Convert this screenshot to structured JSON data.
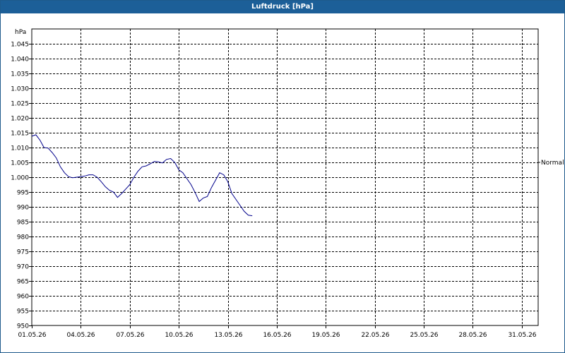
{
  "window": {
    "title": "Luftdruck [hPa]"
  },
  "chart_data": {
    "type": "line",
    "title": "Luftdruck [hPa]",
    "ylabel": "hPa",
    "xlabel": "",
    "ylim": [
      950,
      1050
    ],
    "xlim": [
      "01.05.26",
      "01.06.26"
    ],
    "y_ticks": [
      "950",
      "955",
      "960",
      "965",
      "970",
      "975",
      "980",
      "985",
      "990",
      "995",
      "1.000",
      "1.005",
      "1.010",
      "1.015",
      "1.020",
      "1.025",
      "1.030",
      "1.035",
      "1.040",
      "1.045"
    ],
    "x_ticks": [
      "01.05.26",
      "04.05.26",
      "07.05.26",
      "10.05.26",
      "13.05.26",
      "16.05.26",
      "19.05.26",
      "22.05.26",
      "25.05.26",
      "28.05.26",
      "31.05.26"
    ],
    "grid": true,
    "reference_lines": [
      {
        "label": "Normal",
        "y": 1005
      }
    ],
    "series": [
      {
        "color": "#00008b",
        "x": [
          "01.05.26 00:00",
          "01.05.26 06:00",
          "01.05.26 12:00",
          "01.05.26 18:00",
          "02.05.26 00:00",
          "02.05.26 06:00",
          "02.05.26 12:00",
          "02.05.26 18:00",
          "03.05.26 00:00",
          "03.05.26 06:00",
          "03.05.26 12:00",
          "03.05.26 18:00",
          "04.05.26 00:00",
          "04.05.26 06:00",
          "04.05.26 12:00",
          "04.05.26 18:00",
          "05.05.26 00:00",
          "05.05.26 06:00",
          "05.05.26 12:00",
          "05.05.26 18:00",
          "06.05.26 00:00",
          "06.05.26 06:00",
          "06.05.26 12:00",
          "06.05.26 18:00",
          "07.05.26 00:00",
          "07.05.26 06:00",
          "07.05.26 12:00",
          "07.05.26 18:00",
          "08.05.26 00:00",
          "08.05.26 06:00",
          "08.05.26 12:00",
          "08.05.26 18:00",
          "09.05.26 00:00",
          "09.05.26 06:00",
          "09.05.26 12:00",
          "09.05.26 18:00",
          "10.05.26 00:00",
          "10.05.26 06:00",
          "10.05.26 12:00",
          "10.05.26 18:00",
          "11.05.26 00:00",
          "11.05.26 06:00",
          "11.05.26 12:00",
          "11.05.26 18:00",
          "12.05.26 00:00",
          "12.05.26 06:00",
          "12.05.26 12:00",
          "12.05.26 18:00",
          "13.05.26 00:00",
          "13.05.26 06:00",
          "13.05.26 12:00",
          "13.05.26 18:00",
          "14.05.26 00:00",
          "14.05.26 06:00",
          "14.05.26 12:00"
        ],
        "y": [
          1013.8,
          1014.3,
          1012.5,
          1010.0,
          1009.8,
          1008.3,
          1006.5,
          1003.5,
          1001.5,
          1000.2,
          999.8,
          1000.0,
          1000.2,
          1000.4,
          1000.8,
          1000.8,
          1000.0,
          998.5,
          996.8,
          995.6,
          995.0,
          993.2,
          994.5,
          996.0,
          997.5,
          1000.0,
          1002.0,
          1003.5,
          1003.8,
          1004.5,
          1005.3,
          1005.2,
          1004.8,
          1006.0,
          1006.3,
          1005.0,
          1002.5,
          1001.5,
          999.5,
          997.5,
          994.8,
          991.8,
          993.0,
          993.5,
          996.5,
          999.0,
          1001.5,
          1000.8,
          998.5,
          994.5,
          992.5,
          990.5,
          988.5,
          987.2,
          987.0
        ]
      }
    ]
  }
}
